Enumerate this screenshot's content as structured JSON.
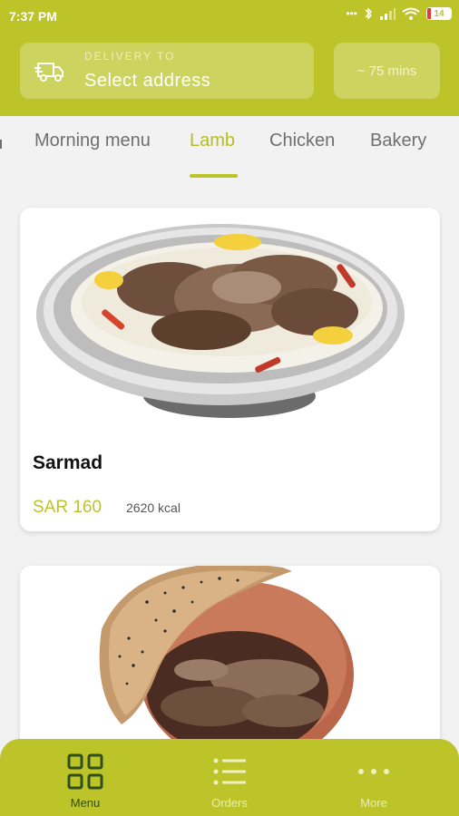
{
  "status_bar": {
    "time": "7:37 PM",
    "battery_level": "14",
    "icons": [
      "dots-icon",
      "bluetooth-icon",
      "signal-icon",
      "wifi-icon",
      "battery-icon"
    ]
  },
  "header": {
    "delivery_label": "DELIVERY TO",
    "address_placeholder": "Select address",
    "eta": "~ 75 mins"
  },
  "tabs": [
    {
      "label": "Morning menu",
      "active": false
    },
    {
      "label": "Lamb",
      "active": true
    },
    {
      "label": "Chicken",
      "active": false
    },
    {
      "label": "Bakery",
      "active": false
    }
  ],
  "dishes": [
    {
      "name": "Sarmad",
      "price": "SAR 160",
      "kcal": "2620 kcal"
    },
    {
      "name": "",
      "price": "",
      "kcal": ""
    }
  ],
  "bottom_nav": [
    {
      "label": "Menu",
      "icon": "grid-icon",
      "active": true
    },
    {
      "label": "Orders",
      "icon": "list-icon",
      "active": false
    },
    {
      "label": "More",
      "icon": "more-dots-icon",
      "active": false
    }
  ],
  "colors": {
    "brand": "#bdc42a",
    "active_nav": "#2f4f1a",
    "inactive_nav": "#e9edb0"
  }
}
